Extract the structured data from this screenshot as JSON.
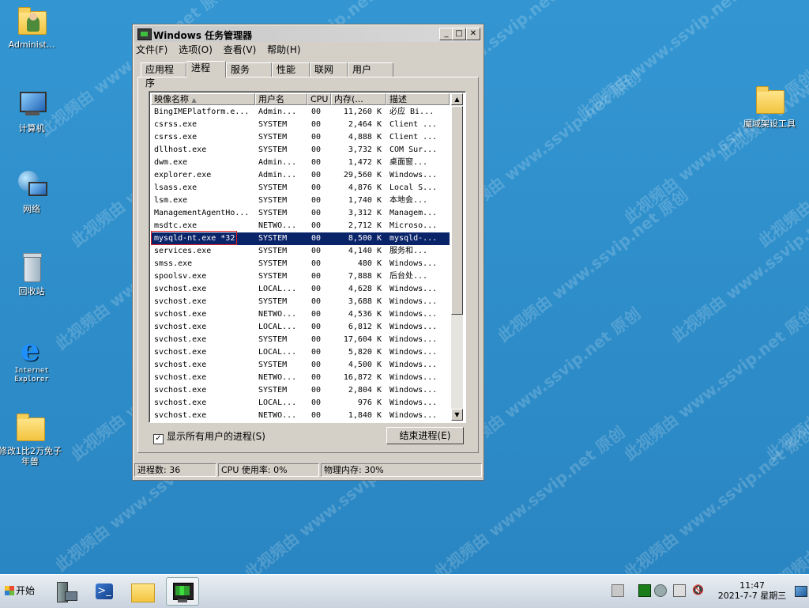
{
  "desktop": {
    "watermark_text": "此视频由 www.ssvip.net 原创",
    "icons": [
      {
        "name": "admin-folder",
        "label": "Administ..."
      },
      {
        "name": "computer",
        "label": "计算机"
      },
      {
        "name": "network",
        "label": "网络"
      },
      {
        "name": "recycle-bin",
        "label": "回收站"
      },
      {
        "name": "ie",
        "label": "Internet Explorer"
      },
      {
        "name": "mod-folder",
        "label": "修改1比2万免子年兽"
      },
      {
        "name": "tool-folder",
        "label": "魔域架设工具"
      }
    ]
  },
  "window": {
    "title": "Windows 任务管理器",
    "menu": [
      "文件(F)",
      "选项(O)",
      "查看(V)",
      "帮助(H)"
    ],
    "tabs": [
      "应用程序",
      "进程",
      "服务",
      "性能",
      "联网",
      "用户"
    ],
    "active_tab": 1,
    "columns": [
      "映像名称",
      "用户名",
      "CPU",
      "内存(...",
      "描述"
    ],
    "processes": [
      {
        "name": "BingIMEPlatform.e...",
        "user": "Admin...",
        "cpu": "00",
        "mem": "11,260 K",
        "desc": "必应 Bi..."
      },
      {
        "name": "csrss.exe",
        "user": "SYSTEM",
        "cpu": "00",
        "mem": "2,464 K",
        "desc": "Client ..."
      },
      {
        "name": "csrss.exe",
        "user": "SYSTEM",
        "cpu": "00",
        "mem": "4,888 K",
        "desc": "Client ..."
      },
      {
        "name": "dllhost.exe",
        "user": "SYSTEM",
        "cpu": "00",
        "mem": "3,732 K",
        "desc": "COM Sur..."
      },
      {
        "name": "dwm.exe",
        "user": "Admin...",
        "cpu": "00",
        "mem": "1,472 K",
        "desc": "桌面窗..."
      },
      {
        "name": "explorer.exe",
        "user": "Admin...",
        "cpu": "00",
        "mem": "29,560 K",
        "desc": "Windows..."
      },
      {
        "name": "lsass.exe",
        "user": "SYSTEM",
        "cpu": "00",
        "mem": "4,876 K",
        "desc": "Local S..."
      },
      {
        "name": "lsm.exe",
        "user": "SYSTEM",
        "cpu": "00",
        "mem": "1,740 K",
        "desc": "本地会..."
      },
      {
        "name": "ManagementAgentHo...",
        "user": "SYSTEM",
        "cpu": "00",
        "mem": "3,312 K",
        "desc": "Managem..."
      },
      {
        "name": "msdtc.exe",
        "user": "NETWO...",
        "cpu": "00",
        "mem": "2,712 K",
        "desc": "Microso..."
      },
      {
        "name": "mysqld-nt.exe *32",
        "user": "SYSTEM",
        "cpu": "00",
        "mem": "8,500 K",
        "desc": "mysqld-..."
      },
      {
        "name": "services.exe",
        "user": "SYSTEM",
        "cpu": "00",
        "mem": "4,140 K",
        "desc": "服务和..."
      },
      {
        "name": "smss.exe",
        "user": "SYSTEM",
        "cpu": "00",
        "mem": "480 K",
        "desc": "Windows..."
      },
      {
        "name": "spoolsv.exe",
        "user": "SYSTEM",
        "cpu": "00",
        "mem": "7,888 K",
        "desc": "后台处..."
      },
      {
        "name": "svchost.exe",
        "user": "LOCAL...",
        "cpu": "00",
        "mem": "4,628 K",
        "desc": "Windows..."
      },
      {
        "name": "svchost.exe",
        "user": "SYSTEM",
        "cpu": "00",
        "mem": "3,688 K",
        "desc": "Windows..."
      },
      {
        "name": "svchost.exe",
        "user": "NETWO...",
        "cpu": "00",
        "mem": "4,536 K",
        "desc": "Windows..."
      },
      {
        "name": "svchost.exe",
        "user": "LOCAL...",
        "cpu": "00",
        "mem": "6,812 K",
        "desc": "Windows..."
      },
      {
        "name": "svchost.exe",
        "user": "SYSTEM",
        "cpu": "00",
        "mem": "17,604 K",
        "desc": "Windows..."
      },
      {
        "name": "svchost.exe",
        "user": "LOCAL...",
        "cpu": "00",
        "mem": "5,820 K",
        "desc": "Windows..."
      },
      {
        "name": "svchost.exe",
        "user": "SYSTEM",
        "cpu": "00",
        "mem": "4,500 K",
        "desc": "Windows..."
      },
      {
        "name": "svchost.exe",
        "user": "NETWO...",
        "cpu": "00",
        "mem": "16,872 K",
        "desc": "Windows..."
      },
      {
        "name": "svchost.exe",
        "user": "SYSTEM",
        "cpu": "00",
        "mem": "2,804 K",
        "desc": "Windows..."
      },
      {
        "name": "svchost.exe",
        "user": "LOCAL...",
        "cpu": "00",
        "mem": "976 K",
        "desc": "Windows..."
      },
      {
        "name": "svchost.exe",
        "user": "NETWO...",
        "cpu": "00",
        "mem": "1,840 K",
        "desc": "Windows..."
      }
    ],
    "selected_row": 10,
    "show_all_label": "显示所有用户的进程(S)",
    "show_all_checked": true,
    "end_process_label": "结束进程(E)",
    "status": {
      "procs": "进程数: 36",
      "cpu": "CPU 使用率: 0%",
      "mem": "物理内存: 30%"
    }
  },
  "taskbar": {
    "start_label": "开始",
    "items": [
      "server-manager",
      "powershell",
      "explorer",
      "task-manager"
    ],
    "clock_time": "11:47",
    "clock_date": "2021-7-7 星期三"
  },
  "colors": {
    "desktop": "#2e8fc9",
    "selection": "#0a246a",
    "highlight_box": "#e02020"
  }
}
